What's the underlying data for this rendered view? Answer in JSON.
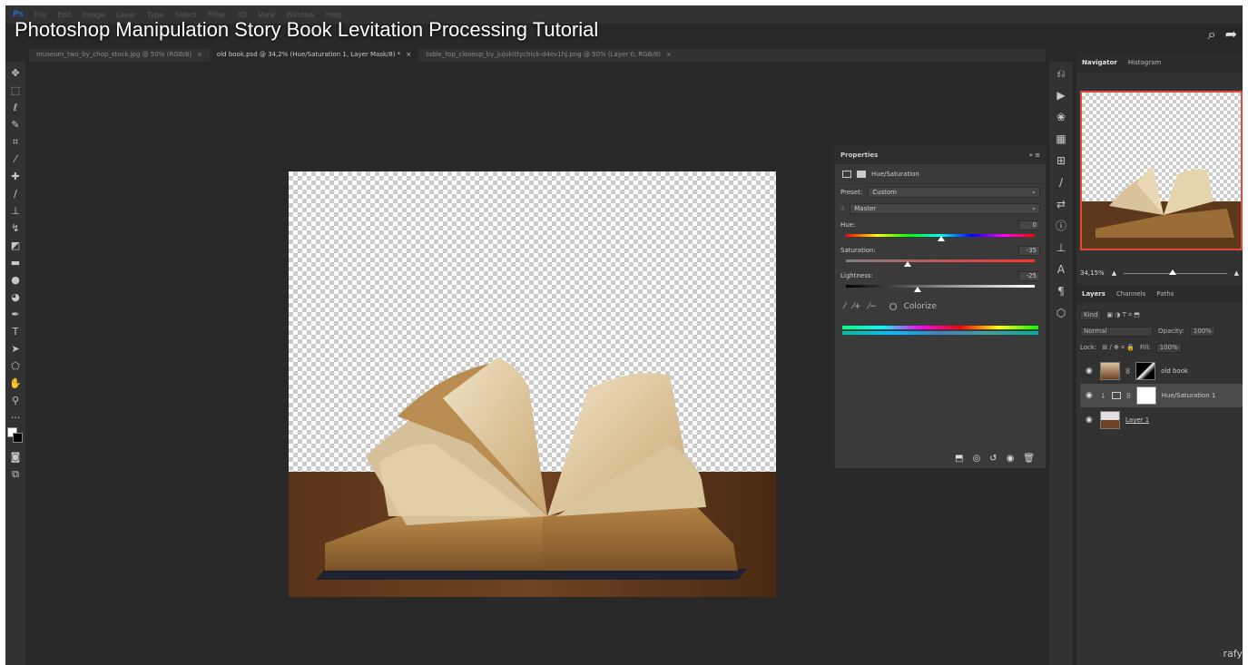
{
  "app": {
    "logo": "Ps"
  },
  "menu": [
    "File",
    "Edit",
    "Image",
    "Layer",
    "Type",
    "Select",
    "Filter",
    "3D",
    "View",
    "Window",
    "Help"
  ],
  "video": {
    "title": "Photoshop Manipulation Story Book Levitation Processing Tutorial",
    "credit": "rafy"
  },
  "tabs": [
    {
      "label": "museum_two_by_chop_stock.jpg @ 50% (RGB/8)"
    },
    {
      "label": "old book.psd @ 34,2% (Hue/Saturation 1, Layer Mask/8) *"
    },
    {
      "label": "table_top_closeup_by_jujukittychick-d4ev1hj.png @ 50% (Layer 0, RGB/8)"
    }
  ],
  "properties": {
    "title": "Properties",
    "adjustment": "Hue/Saturation",
    "preset_label": "Preset:",
    "preset_value": "Custom",
    "channel": "Master",
    "hue": {
      "label": "Hue:",
      "value": "0",
      "level": 0
    },
    "saturation": {
      "label": "Saturation:",
      "value": "-35",
      "level": -35
    },
    "lightness": {
      "label": "Lightness:",
      "value": "-25",
      "level": -25
    },
    "colorize": "Colorize"
  },
  "navigator": {
    "tabs": [
      "Navigator",
      "Histogram"
    ],
    "zoom": "34,15%"
  },
  "layers": {
    "tabs": [
      "Layers",
      "Channels",
      "Paths"
    ],
    "kind": "Kind",
    "filter_icons": "▣ ◑ T ⌗ ⬒",
    "blend_mode": "Normal",
    "opacity_label": "Opacity:",
    "opacity": "100%",
    "lock_label": "Lock:",
    "lock_icons": "⊞ ∕ ✥ ⌗ 🔒",
    "fill_label": "Fill:",
    "fill": "100%",
    "items": [
      {
        "name": "old book"
      },
      {
        "name": "Hue/Saturation 1"
      },
      {
        "name": "Layer 1"
      }
    ]
  }
}
